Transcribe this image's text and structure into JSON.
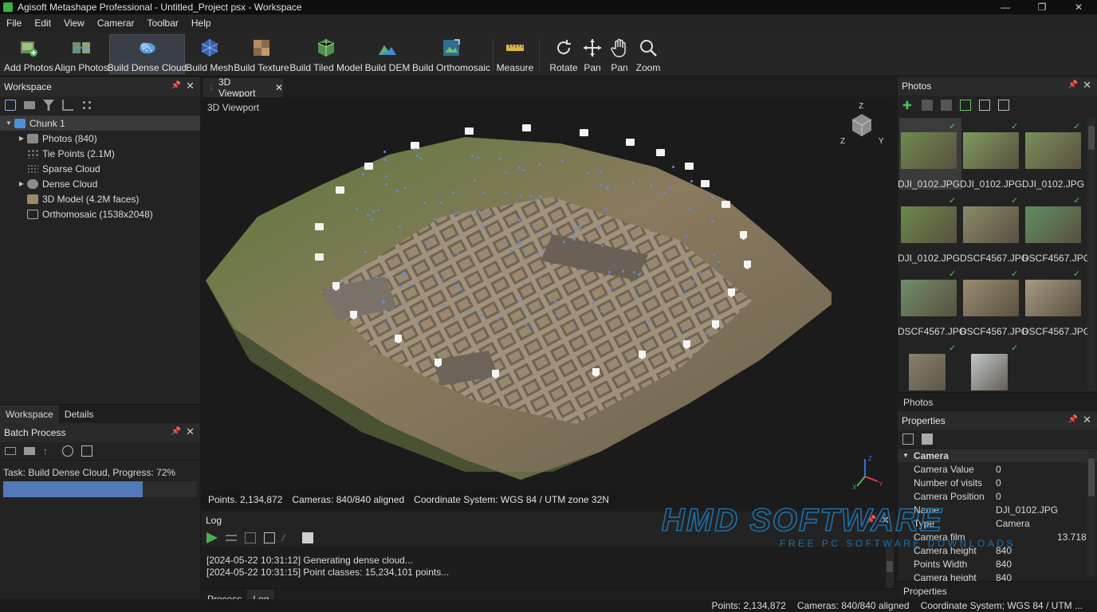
{
  "window": {
    "title": "Agisoft Metashape Professional - Untitled_Project psx - Workspace",
    "minimize": "—",
    "restore": "❐",
    "close": "✕"
  },
  "menu": [
    "File",
    "Edit",
    "View",
    "Camerar",
    "Toolbar",
    "Help"
  ],
  "toolbar": {
    "add_photos": "Add Photos",
    "align_photos": "Align Photos",
    "build_dense_cloud": "Build Dense Cloud",
    "build_mesh": "Build Mesh",
    "build_texture": "Build Texture",
    "build_tiled_model": "Build Tiled Model",
    "build_dem": "Build DEM",
    "build_orthomosaic": "Build Orthomosaic",
    "measure": "Measure",
    "rotate": "Rotate",
    "pan": "Pan",
    "pan2": "Pan",
    "zoom": "Zoom"
  },
  "workspace": {
    "title": "Workspace",
    "chunk": "Chunk 1",
    "items": [
      "Photos (840)",
      "Tie Points (2.1M)",
      "Sparse Cloud",
      "Dense Cloud",
      "3D Model (4.2M faces)",
      "Orthomosaic (1538x2048)"
    ],
    "tabs": [
      "Workspace",
      "Details"
    ]
  },
  "batch": {
    "title": "Batch Process",
    "task": "Task: Build Dense Cloud, Progress: 72%",
    "progress": 0.72
  },
  "viewport": {
    "tab": "3D Viewport",
    "label": "3D Viewport",
    "axes": {
      "z": "Z",
      "y": "Y",
      "x": "X"
    },
    "points": "Points. 2,134,872",
    "cameras": "Cameras: 840/840 aligned",
    "coord": "Coordinate System: WGS 84 / UTM zone 32N"
  },
  "log": {
    "title": "Log",
    "lines": [
      "[2024-05-22 10:31:12] Generating dense cloud...",
      "[2024-05-22 10:31:15] Point classes: 15,234,101 points..."
    ],
    "tabs": [
      "Process",
      "Log"
    ]
  },
  "photos": {
    "title": "Photos",
    "captions": [
      "DJI_0102.JPG",
      "DJI_0102.JPG",
      "DJI_0102.JPG",
      "DJI_0102.JPG",
      "DSCF4567.JPG",
      "DSCF4567.JPG",
      "DSCF4567.JPG",
      "DSCF4567.JPG",
      "DSCF4567.JPG"
    ],
    "check": "✓",
    "tab": "Photos"
  },
  "properties": {
    "title": "Properties",
    "group": "Camera",
    "rows": [
      {
        "k": "Camera Value",
        "v": "0"
      },
      {
        "k": "Number of visits",
        "v": "0"
      },
      {
        "k": "Camera Position",
        "v": "0"
      },
      {
        "k": "Name",
        "v": "DJI_0102.JPG"
      },
      {
        "k": "Type",
        "v": "Camera"
      },
      {
        "k": "Camera film",
        "v": "13.718"
      },
      {
        "k": "Camera height",
        "v": "840"
      },
      {
        "k": "Points Width",
        "v": "840"
      },
      {
        "k": "Camera height",
        "v": "840"
      }
    ],
    "tab": "Properties"
  },
  "statusbar": {
    "points": "Points: 2,134,872",
    "cameras": "Cameras: 840/840 aligned",
    "coord": "Coordinate System; WGS 84 / UTM ..."
  },
  "watermark": {
    "brand": "HMD SOFTWARE",
    "tagline": "FREE PC SOFTWARE DOWNLOADS"
  }
}
